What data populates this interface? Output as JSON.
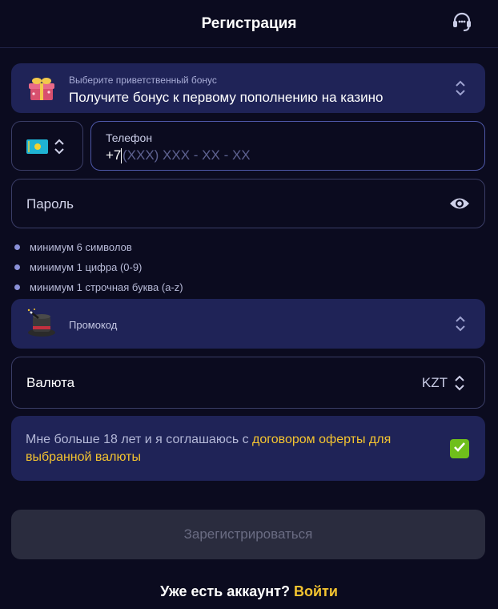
{
  "header": {
    "title": "Регистрация",
    "support_icon": "headset-icon"
  },
  "bonus": {
    "label": "Выберите приветственный бонус",
    "value": "Получите бонус к первому пополнению на казино",
    "icon": "gift-box-icon"
  },
  "country": {
    "flag": "kazakhstan-flag-icon"
  },
  "phone": {
    "label": "Телефон",
    "prefix": "+7",
    "mask": "(XXX) XXX - XX - XX"
  },
  "password": {
    "placeholder": "Пароль",
    "icon": "eye-icon"
  },
  "password_rules": [
    {
      "text": "минимум 6 символов"
    },
    {
      "text": "минимум 1 цифра (0-9)"
    },
    {
      "text": "минимум 1 строчная буква (a-z)"
    }
  ],
  "promo": {
    "label": "Промокод",
    "icon": "magic-hat-icon"
  },
  "currency": {
    "label": "Валюта",
    "value": "KZT"
  },
  "agreement": {
    "text": "Мне больше 18 лет и я соглашаюсь с ",
    "link_text": "договором оферты для выбранной валюты",
    "checked": true
  },
  "submit": {
    "label": "Зарегистрироваться"
  },
  "footer": {
    "question": "Уже есть аккаунт?",
    "login_link": "Войти"
  },
  "colors": {
    "background": "#0b0b1f",
    "card": "#1f2357",
    "accent_link": "#f4c430",
    "checkbox": "#6fbf1b",
    "button_disabled": "#2a2c3e"
  }
}
